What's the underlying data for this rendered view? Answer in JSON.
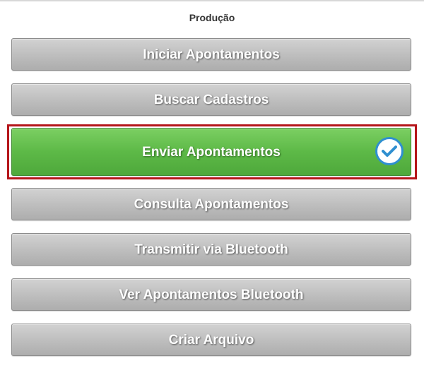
{
  "header": {
    "title": "Produção"
  },
  "menu": {
    "items": [
      {
        "label": "Iniciar Apontamentos"
      },
      {
        "label": "Buscar Cadastros"
      },
      {
        "label": "Enviar Apontamentos",
        "selected": true,
        "icon": "check-icon"
      },
      {
        "label": "Consulta Apontamentos"
      },
      {
        "label": "Transmitir via Bluetooth"
      },
      {
        "label": "Ver Apontamentos Bluetooth"
      },
      {
        "label": "Criar Arquivo"
      }
    ]
  },
  "colors": {
    "selected_green": "#5db947",
    "selection_border": "#b5151a",
    "check_blue": "#2f8fd0",
    "button_gray": "#bdbdbd"
  }
}
